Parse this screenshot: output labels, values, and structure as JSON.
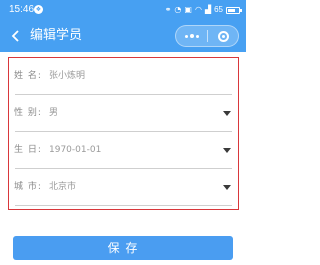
{
  "status_bar": {
    "time": "15:46",
    "app_badge": "❖",
    "icons": [
      "link-icon",
      "bell-icon",
      "nfc-icon",
      "wifi-icon",
      "signal-icon"
    ],
    "battery_level": 0.65,
    "battery_text": "65"
  },
  "nav": {
    "back_icon": "chevron-left-icon",
    "title": "编辑学员",
    "menu_icon": "more-dots-icon",
    "close_icon": "circle-close-icon"
  },
  "form": {
    "fields": [
      {
        "label": "姓 名:",
        "placeholder": "张小炼明",
        "value": "",
        "type": "text"
      },
      {
        "label": "性 别:",
        "value": "男",
        "type": "picker"
      },
      {
        "label": "生 日:",
        "value": "1970-01-01",
        "type": "picker"
      },
      {
        "label": "城 市:",
        "value": "北京市",
        "type": "picker"
      }
    ]
  },
  "actions": {
    "save_label": "保 存"
  },
  "colors": {
    "primary": "#47a0f2",
    "button": "#4a9df1",
    "highlight_border": "#d9373b"
  }
}
